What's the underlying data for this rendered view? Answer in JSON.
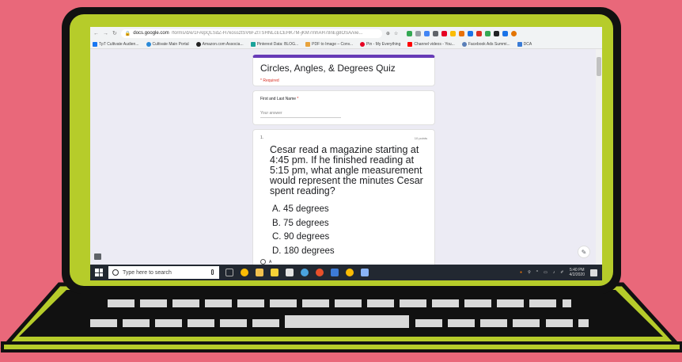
{
  "browser": {
    "url_host": "docs.google.com",
    "url_path": "/forms/d/e/1FAIpQLSdZ-H7kossztSV6FZtTSHNLcECEHK7M-jKM7mhAH78nEg8OSA/vie...",
    "bookmarks": [
      {
        "label": "TpT Cultivate Audien...",
        "color": "#1877f2"
      },
      {
        "label": "Cultivate Main Portal",
        "color": "#2a8ad8"
      },
      {
        "label": "Amazon.com Associa...",
        "color": "#222222"
      },
      {
        "label": "Pinterest Data: BLOG...",
        "color": "#1aa39a"
      },
      {
        "label": "PDF to Image – Conv...",
        "color": "#e8a33d"
      },
      {
        "label": "Pin - My Everything",
        "color": "#e60023"
      },
      {
        "label": "Channel videos - You...",
        "color": "#ff0000"
      },
      {
        "label": "Facebook Ads Summi...",
        "color": "#5a7fb8"
      },
      {
        "label": "DCA",
        "color": "#3a7bd5"
      }
    ]
  },
  "form": {
    "title": "Circles, Angles, & Degrees Quiz",
    "required_note": "* Required",
    "name_label": "First and Last Name",
    "name_required": "*",
    "name_placeholder": "Your answer",
    "question": {
      "number": "1.",
      "points": "10 points",
      "text": "Cesar read a magazine starting at 4:45 pm. If he finished reading at 5:15 pm, what angle measurement would represent the minutes Cesar spent reading?",
      "options": [
        "A.  45 degrees",
        "B.  75 degrees",
        "C.  90 degrees",
        "D.  180 degrees"
      ],
      "radio_first_label": "A"
    }
  },
  "taskbar": {
    "search_placeholder": "Type here to search",
    "time": "5:40 PM",
    "date": "4/2/2020",
    "notification_count": "16"
  },
  "colors": {
    "background": "#e9687a",
    "laptop_body": "#b6cc2a",
    "form_accent": "#673ab7"
  }
}
